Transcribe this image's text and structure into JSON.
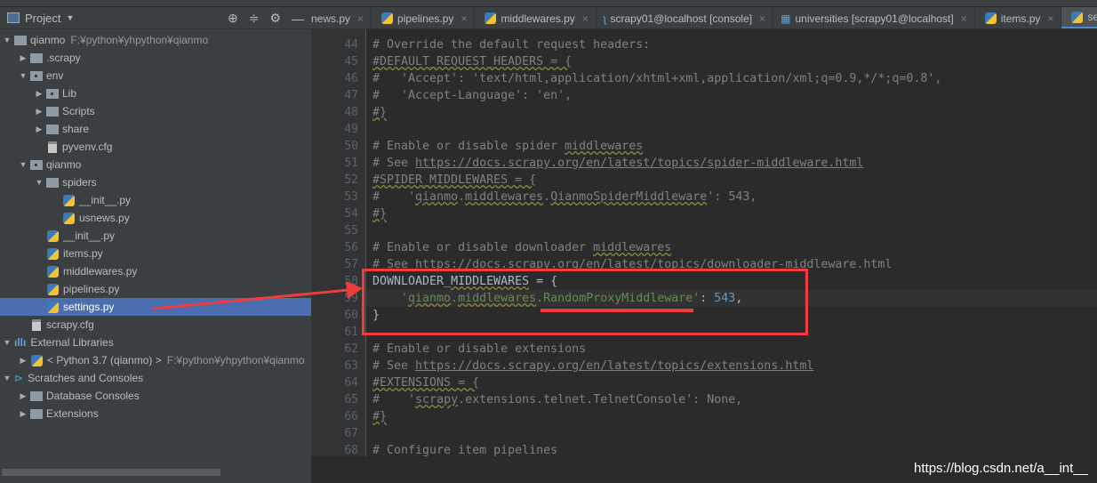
{
  "project": {
    "title": "Project",
    "tools": [
      "locate-icon",
      "collapse-icon",
      "gear-icon",
      "minimize-icon"
    ]
  },
  "tree": [
    {
      "label": "qianmo",
      "path": "F:¥python¥yhpython¥qianmo",
      "level": 0,
      "icon": "folder",
      "open": true
    },
    {
      "label": ".scrapy",
      "level": 1,
      "icon": "folder",
      "open": false
    },
    {
      "label": "env",
      "level": 1,
      "icon": "package",
      "open": true
    },
    {
      "label": "Lib",
      "level": 2,
      "icon": "package",
      "open": false
    },
    {
      "label": "Scripts",
      "level": 2,
      "icon": "folder",
      "open": false
    },
    {
      "label": "share",
      "level": 2,
      "icon": "folder",
      "open": false
    },
    {
      "label": "pyvenv.cfg",
      "level": 2,
      "icon": "cfg"
    },
    {
      "label": "qianmo",
      "level": 1,
      "icon": "package",
      "open": true
    },
    {
      "label": "spiders",
      "level": 2,
      "icon": "folder",
      "open": true
    },
    {
      "label": "__init__.py",
      "level": 3,
      "icon": "python"
    },
    {
      "label": "usnews.py",
      "level": 3,
      "icon": "python"
    },
    {
      "label": "__init__.py",
      "level": 2,
      "icon": "python"
    },
    {
      "label": "items.py",
      "level": 2,
      "icon": "python"
    },
    {
      "label": "middlewares.py",
      "level": 2,
      "icon": "python"
    },
    {
      "label": "pipelines.py",
      "level": 2,
      "icon": "python"
    },
    {
      "label": "settings.py",
      "level": 2,
      "icon": "python",
      "selected": true
    },
    {
      "label": "scrapy.cfg",
      "level": 1,
      "icon": "cfg"
    },
    {
      "label": "External Libraries",
      "level": 0,
      "icon": "libraries",
      "open": true
    },
    {
      "label": "< Python 3.7 (qianmo) >",
      "path": "F:¥python¥yhpython¥qianmo",
      "level": 1,
      "icon": "python",
      "open": false
    },
    {
      "label": "Scratches and Consoles",
      "level": 0,
      "icon": "scratches",
      "open": true
    },
    {
      "label": "Database Consoles",
      "level": 1,
      "icon": "folder",
      "open": false
    },
    {
      "label": "Extensions",
      "level": 1,
      "icon": "folder",
      "open": false
    }
  ],
  "tabs": [
    {
      "label": "news.py",
      "icon": "python"
    },
    {
      "label": "pipelines.py",
      "icon": "python"
    },
    {
      "label": "middlewares.py",
      "icon": "python"
    },
    {
      "label": "scrapy01@localhost [console]",
      "icon": "console"
    },
    {
      "label": "universities [scrapy01@localhost]",
      "icon": "table"
    },
    {
      "label": "items.py",
      "icon": "python"
    },
    {
      "label": "settings.py",
      "icon": "python",
      "active": true
    }
  ],
  "editor": {
    "first_line": 44,
    "current_line": 59,
    "lines": [
      [
        [
          "# Override the default request headers:",
          "c"
        ]
      ],
      [
        [
          "#DEFAULT_REQUEST_HEADERS = {",
          "c w"
        ]
      ],
      [
        [
          "#   'Accept': 'text/html,application/xhtml+xml,application/xml;q=0.9,*/*;q=0.8',",
          "c"
        ]
      ],
      [
        [
          "#   'Accept-Language': 'en',",
          "c"
        ]
      ],
      [
        [
          "#}",
          "c w"
        ]
      ],
      [
        [
          "",
          ""
        ]
      ],
      [
        [
          "# Enable or disable spider ",
          "c"
        ],
        [
          "middlewares",
          "c w"
        ]
      ],
      [
        [
          "# See ",
          "c"
        ],
        [
          "https://docs.scrapy.org/en/latest/topics/spider-middleware.html",
          "c u"
        ]
      ],
      [
        [
          "#SPIDER_MIDDLEWARES = {",
          "c w"
        ]
      ],
      [
        [
          "#    '",
          "c"
        ],
        [
          "qianmo",
          "c w"
        ],
        [
          ".",
          "c"
        ],
        [
          "middlewares",
          "c w"
        ],
        [
          ".",
          "c"
        ],
        [
          "QianmoSpiderMiddleware",
          "c w"
        ],
        [
          "': 543,",
          "c"
        ]
      ],
      [
        [
          "#}",
          "c w"
        ]
      ],
      [
        [
          "",
          ""
        ]
      ],
      [
        [
          "# Enable or disable downloader ",
          "c"
        ],
        [
          "middlewares",
          "c w"
        ]
      ],
      [
        [
          "# See https://docs.scrapy.org/en/latest/topics/downloader-middleware.html",
          "c"
        ]
      ],
      [
        [
          "DOWNLOADER_",
          ""
        ],
        [
          "MIDDLEWARES",
          "w"
        ],
        [
          " = {",
          ""
        ]
      ],
      [
        [
          "    '",
          "s"
        ],
        [
          "qianmo",
          "s w"
        ],
        [
          ".",
          "s"
        ],
        [
          "middlewares",
          "s w"
        ],
        [
          ".RandomProxyMiddleware'",
          "s"
        ],
        [
          ": ",
          ""
        ],
        [
          "543",
          "n"
        ],
        [
          ",",
          ""
        ]
      ],
      [
        [
          "}",
          ""
        ]
      ],
      [
        [
          "",
          ""
        ]
      ],
      [
        [
          "# Enable or disable extensions",
          "c"
        ]
      ],
      [
        [
          "# See ",
          "c"
        ],
        [
          "https://docs.scrapy.org/en/latest/topics/extensions.html",
          "c u"
        ]
      ],
      [
        [
          "#EXTENSIONS = {",
          "c w"
        ]
      ],
      [
        [
          "#    '",
          "c"
        ],
        [
          "scrapy",
          "c w"
        ],
        [
          ".extensions.telnet.TelnetConsole': None,",
          "c"
        ]
      ],
      [
        [
          "#}",
          "c w"
        ]
      ],
      [
        [
          "",
          ""
        ]
      ],
      [
        [
          "# Configure item pipelines",
          "c"
        ]
      ]
    ]
  },
  "colors": {
    "annotation": "#f03c3c",
    "selection": "#4b6eaf"
  },
  "watermark": "https://blog.csdn.net/a__int__"
}
